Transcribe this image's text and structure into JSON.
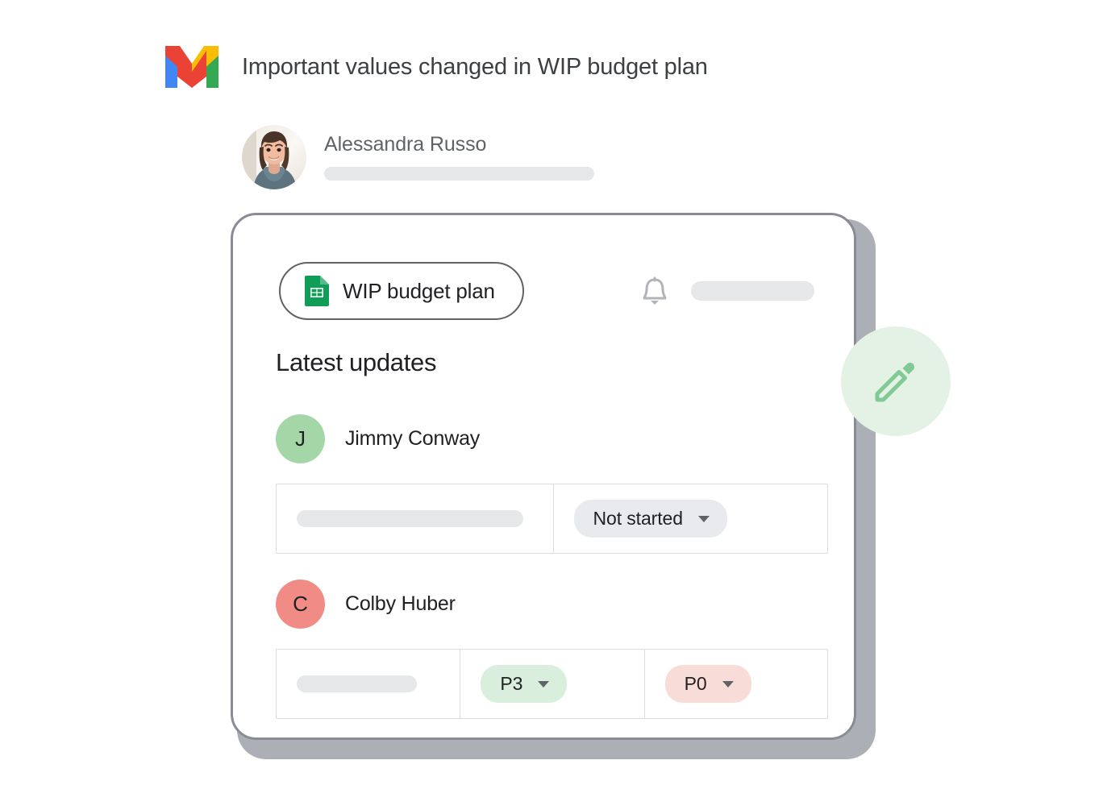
{
  "email": {
    "app_icon": "gmail-logo-icon",
    "subject": "Important values changed in WIP budget plan",
    "sender": {
      "name": "Alessandra Russo",
      "avatar": "sender-photo-avatar",
      "snippet_placeholder": ""
    }
  },
  "card": {
    "document_chip": {
      "icon": "google-sheets-icon",
      "label": "WIP budget plan"
    },
    "notification": {
      "icon": "bell-icon",
      "placeholder": ""
    },
    "section_title": "Latest updates",
    "updates": [
      {
        "person": {
          "initial": "J",
          "name": "Jimmy Conway",
          "avatar_color": "#a5d6a7"
        },
        "row": {
          "placeholder": "",
          "fields": [
            {
              "value": "Not started",
              "style": "gray",
              "icon": "chevron-down-icon"
            }
          ]
        }
      },
      {
        "person": {
          "initial": "C",
          "name": "Colby Huber",
          "avatar_color": "#f08b85"
        },
        "row": {
          "placeholder": "",
          "fields": [
            {
              "value": "P3",
              "style": "green",
              "icon": "chevron-down-icon"
            },
            {
              "value": "P0",
              "style": "red",
              "icon": "chevron-down-icon"
            }
          ]
        }
      }
    ],
    "edit_fab": {
      "icon": "pencil-icon",
      "background": "#e4f2e6",
      "icon_color": "#81c995"
    }
  },
  "colors": {
    "gmail_red": "#ea4335",
    "gmail_blue": "#4285f4",
    "gmail_yellow": "#fbbc04",
    "gmail_green": "#34a853",
    "sheets_green": "#0f9d58",
    "chip_gray": "#e8eaed",
    "chip_green": "#d9eedd",
    "chip_red": "#f8dcd8",
    "text_primary": "#202124",
    "text_secondary": "#5f6368",
    "placeholder_gray": "#e6e7e9",
    "card_border": "#8a8c95"
  }
}
